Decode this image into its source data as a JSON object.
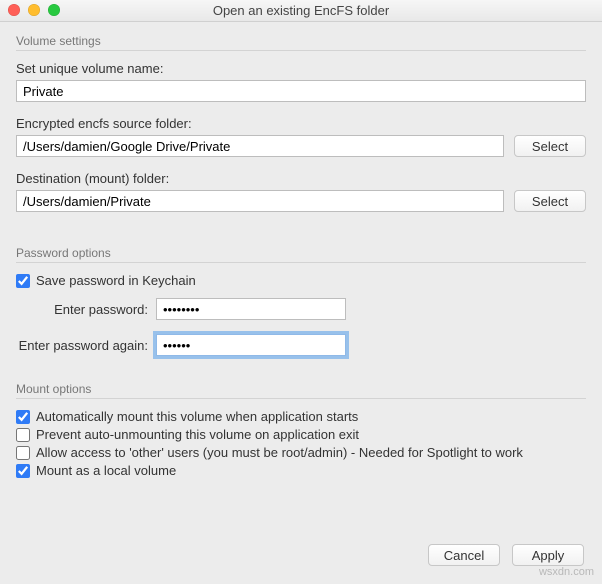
{
  "window": {
    "title": "Open an existing EncFS folder"
  },
  "volume_settings": {
    "section_label": "Volume settings",
    "name_label": "Set unique volume name:",
    "name_value": "Private",
    "source_label": "Encrypted encfs source folder:",
    "source_value": "/Users/damien/Google Drive/Private",
    "dest_label": "Destination (mount) folder:",
    "dest_value": "/Users/damien/Private",
    "select_label": "Select"
  },
  "password_options": {
    "section_label": "Password options",
    "save_keychain_label": "Save password in Keychain",
    "save_keychain_checked": true,
    "enter_label": "Enter password:",
    "enter_value": "••••••••",
    "again_label": "Enter password again:",
    "again_value": "••••••"
  },
  "mount_options": {
    "section_label": "Mount options",
    "opts": [
      {
        "label": "Automatically mount this volume when application starts",
        "checked": true
      },
      {
        "label": "Prevent auto-unmounting this volume on application exit",
        "checked": false
      },
      {
        "label": "Allow access to 'other' users (you must be root/admin) - Needed for Spotlight to work",
        "checked": false
      },
      {
        "label": "Mount as a local volume",
        "checked": true
      }
    ]
  },
  "buttons": {
    "cancel": "Cancel",
    "apply": "Apply"
  },
  "watermark": "wsxdn.com"
}
